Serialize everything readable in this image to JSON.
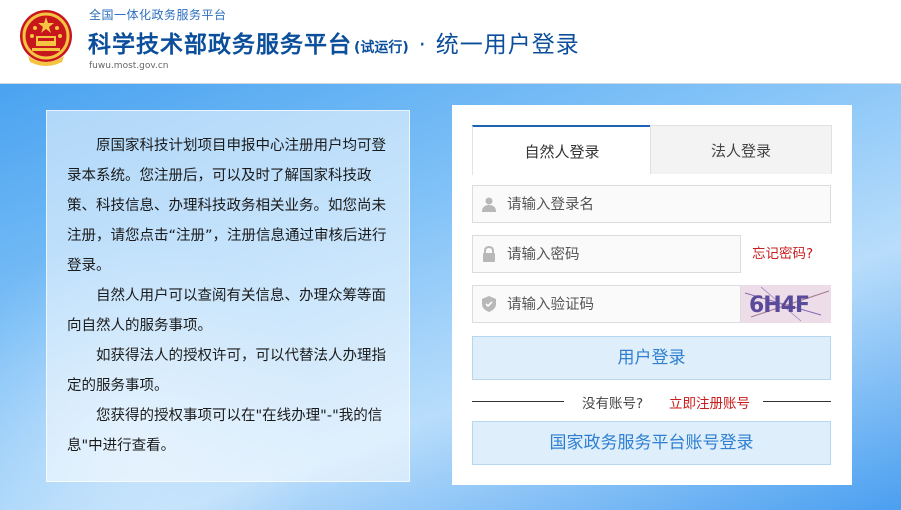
{
  "header": {
    "top_line": "全国一体化政务服务平台",
    "title_main": "科学技术部政务服务平台",
    "title_trial": "(试运行)",
    "title_dot": "·",
    "title_sub": "统一用户登录",
    "domain": "fuwu.most.gov.cn"
  },
  "info": {
    "paragraphs": [
      "原国家科技计划项目申报中心注册用户均可登录本系统。您注册后，可以及时了解国家科技政策、科技信息、办理科技政务相关业务。如您尚未注册，请您点击“注册”，注册信息通过审核后进行登录。",
      "自然人用户可以查阅有关信息、办理众筹等面向自然人的服务事项。",
      "如获得法人的授权许可，可以代替法人办理指定的服务事项。",
      "您获得的授权事项可以在\"在线办理\"-\"我的信息\"中进行查看。"
    ]
  },
  "login": {
    "tabs": [
      {
        "label": "自然人登录",
        "active": true
      },
      {
        "label": "法人登录",
        "active": false
      }
    ],
    "username_placeholder": "请输入登录名",
    "password_placeholder": "请输入密码",
    "captcha_placeholder": "请输入验证码",
    "forgot_label": "忘记密码?",
    "captcha_text": "6H4F",
    "login_button": "用户登录",
    "no_account": "没有账号?",
    "register_link": "立即注册账号",
    "national_button": "国家政务服务平台账号登录"
  },
  "colors": {
    "brand_blue": "#0b4f9c",
    "link_red": "#c91d1d",
    "button_text": "#2e7fd1",
    "button_bg": "#deeefb"
  },
  "icons": {
    "emblem": "national-emblem-icon",
    "username": "user-icon",
    "password": "lock-icon",
    "captcha": "shield-icon"
  }
}
